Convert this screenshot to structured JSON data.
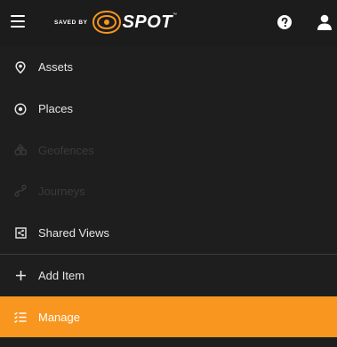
{
  "header": {
    "menu_icon": "hamburger-icon",
    "logo_prefix": "SAVED BY",
    "logo_name": "SPOT",
    "logo_tm": "™",
    "help_icon": "question-circle-icon",
    "user_icon": "user-icon"
  },
  "menu": {
    "items": [
      {
        "label": "Assets",
        "icon": "map-pin-icon",
        "enabled": true
      },
      {
        "label": "Places",
        "icon": "target-circle-icon",
        "enabled": true
      },
      {
        "label": "Geofences",
        "icon": "geofence-icon",
        "enabled": false
      },
      {
        "label": "Journeys",
        "icon": "route-icon",
        "enabled": false
      },
      {
        "label": "Shared Views",
        "icon": "share-box-icon",
        "enabled": true
      },
      {
        "label": "Add Item",
        "icon": "plus-icon",
        "enabled": true
      },
      {
        "label": "Manage",
        "icon": "checklist-icon",
        "enabled": true,
        "active": true
      }
    ]
  },
  "colors": {
    "background": "#1e1e1e",
    "active": "#f8961f",
    "disabled_text": "#3a3a3a",
    "text": "#e6e6e6"
  }
}
